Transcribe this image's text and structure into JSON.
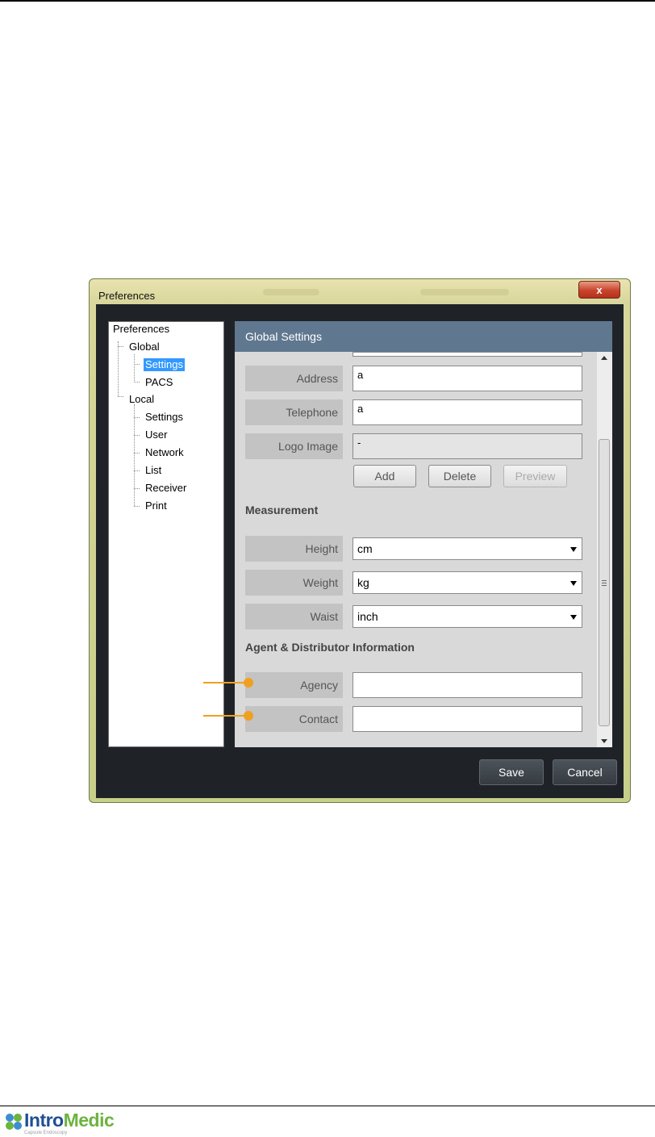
{
  "window": {
    "title": "Preferences",
    "close_label": "x"
  },
  "tree": {
    "root": "Preferences",
    "global": "Global",
    "global_items": [
      "Settings",
      "PACS"
    ],
    "local": "Local",
    "local_items": [
      "Settings",
      "User",
      "Network",
      "List",
      "Receiver",
      "Print"
    ]
  },
  "panel": {
    "title": "Global Settings",
    "address": {
      "label": "Address",
      "value": "a"
    },
    "telephone": {
      "label": "Telephone",
      "value": "a"
    },
    "logo_image": {
      "label": "Logo Image",
      "value": "-"
    },
    "logo_buttons": {
      "add": "Add",
      "delete": "Delete",
      "preview": "Preview"
    },
    "measurement": {
      "heading": "Measurement",
      "height": {
        "label": "Height",
        "value": "cm"
      },
      "weight": {
        "label": "Weight",
        "value": "kg"
      },
      "waist": {
        "label": "Waist",
        "value": "inch"
      }
    },
    "agent": {
      "heading": "Agent & Distributor Information",
      "agency": {
        "label": "Agency",
        "value": ""
      },
      "contact": {
        "label": "Contact",
        "value": ""
      }
    }
  },
  "footer_buttons": {
    "save": "Save",
    "cancel": "Cancel"
  },
  "brand": {
    "logo_intro": "Intro",
    "logo_medic": "Medic",
    "tagline": "Capsule Endoscopy"
  },
  "colors": {
    "accent_callout": "#f0a020",
    "panel_header": "#60788f",
    "tree_selected": "#3399ff"
  }
}
